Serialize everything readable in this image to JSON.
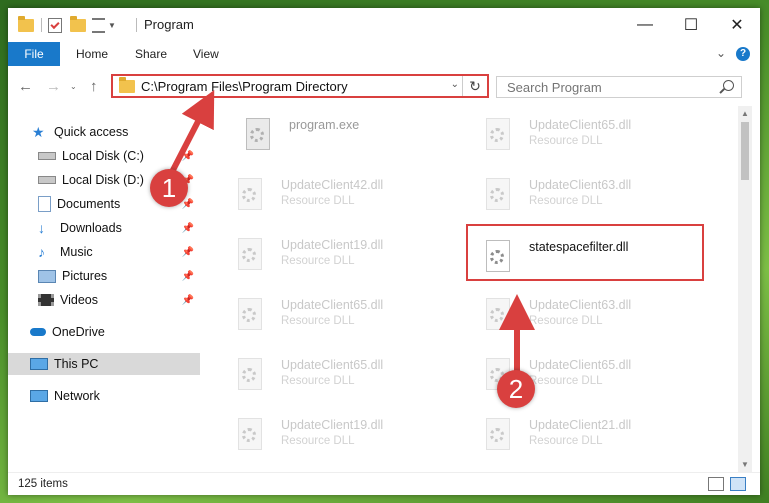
{
  "window": {
    "title": "Program",
    "controls": {
      "minimize": "—",
      "maximize": "☐",
      "close": "✕"
    }
  },
  "ribbon": {
    "tabs": [
      "File",
      "Home",
      "Share",
      "View"
    ],
    "help": "?"
  },
  "address": {
    "path": "C:\\Program Files\\Program Directory"
  },
  "search": {
    "placeholder": "Search Program"
  },
  "sidebar": {
    "items": [
      {
        "label": "Quick access",
        "icon": "star-icon"
      },
      {
        "label": "Local Disk (C:)",
        "icon": "drive-icon",
        "pinned": true
      },
      {
        "label": "Local Disk (D:)",
        "icon": "drive-icon",
        "pinned": true
      },
      {
        "label": "Documents",
        "icon": "documents-icon",
        "pinned": true
      },
      {
        "label": "Downloads",
        "icon": "download-icon",
        "pinned": true
      },
      {
        "label": "Music",
        "icon": "music-icon",
        "pinned": true
      },
      {
        "label": "Pictures",
        "icon": "pictures-icon",
        "pinned": true
      },
      {
        "label": "Videos",
        "icon": "videos-icon",
        "pinned": true
      },
      {
        "label": "OneDrive",
        "icon": "cloud-icon"
      },
      {
        "label": "This PC",
        "icon": "computer-icon",
        "selected": true
      },
      {
        "label": "Network",
        "icon": "network-icon"
      }
    ]
  },
  "files": [
    {
      "name": "program.exe",
      "type": ""
    },
    {
      "name": "UpdateClient65.dll",
      "type": "Resource DLL"
    },
    {
      "name": "UpdateClient42.dll",
      "type": "Resource DLL"
    },
    {
      "name": "UpdateClient63.dll",
      "type": "Resource DLL"
    },
    {
      "name": "UpdateClient19.dll",
      "type": "Resource DLL"
    },
    {
      "name": "statespacefilter.dll",
      "type": "",
      "highlighted": true
    },
    {
      "name": "UpdateClient65.dll",
      "type": "Resource DLL"
    },
    {
      "name": "UpdateClient63.dll",
      "type": "Resource DLL"
    },
    {
      "name": "UpdateClient65.dll",
      "type": "Resource DLL"
    },
    {
      "name": "UpdateClient65.dll",
      "type": "Resource DLL"
    },
    {
      "name": "UpdateClient19.dll",
      "type": "Resource DLL"
    },
    {
      "name": "UpdateClient21.dll",
      "type": "Resource DLL"
    }
  ],
  "status": {
    "count": "125 items"
  },
  "annotations": {
    "step1": "1",
    "step2": "2",
    "color": "#d9403f"
  }
}
